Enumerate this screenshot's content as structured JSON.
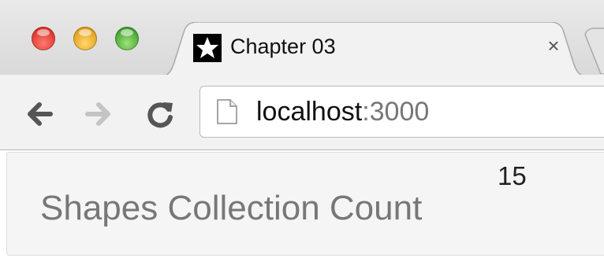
{
  "window": {
    "controls": [
      "close",
      "minimize",
      "maximize"
    ]
  },
  "tab": {
    "title": "Chapter 03",
    "favicon": "star-icon",
    "close_glyph": "×"
  },
  "toolbar": {
    "back_icon": "arrow-left-icon",
    "forward_icon": "arrow-right-icon",
    "reload_icon": "reload-icon",
    "address": {
      "host": "localhost",
      "port": ":3000",
      "icon": "page-icon"
    }
  },
  "page": {
    "label": "Shapes Collection Count",
    "count": "15"
  },
  "colors": {
    "close": "#e2463c",
    "minimize": "#f0b42a",
    "maximize": "#5cbb3e",
    "label_text": "#777777",
    "panel_bg": "#f5f5f5"
  }
}
